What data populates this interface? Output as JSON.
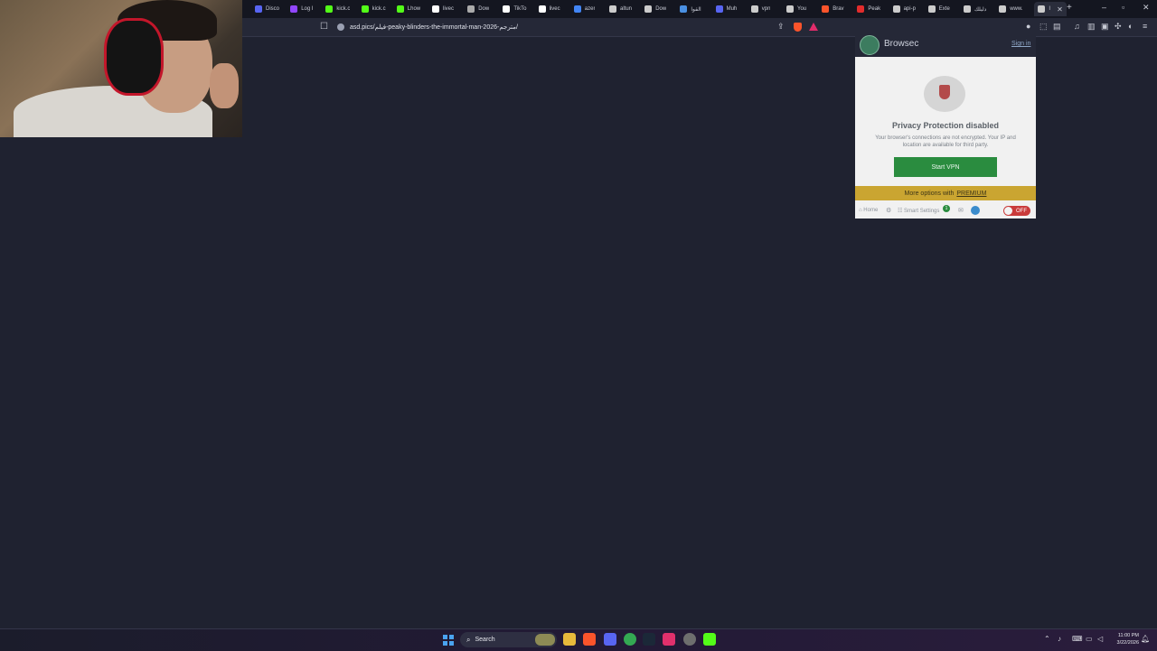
{
  "browser": {
    "tabs": [
      {
        "label": "Disco",
        "color": "#5865f2"
      },
      {
        "label": "Log I",
        "color": "#9146ff"
      },
      {
        "label": "kick.c",
        "color": "#53fc18"
      },
      {
        "label": "kick.c",
        "color": "#53fc18"
      },
      {
        "label": "Lhow",
        "color": "#53fc18"
      },
      {
        "label": "livec",
        "color": "#ffffff"
      },
      {
        "label": "Dow",
        "color": "#aaaaaa"
      },
      {
        "label": "TikTo",
        "color": "#ffffff"
      },
      {
        "label": "livec",
        "color": "#ffffff"
      },
      {
        "label": "azer",
        "color": "#4285f4"
      },
      {
        "label": "altun",
        "color": "#cccccc"
      },
      {
        "label": "Dow",
        "color": "#cccccc"
      },
      {
        "label": "القوا",
        "color": "#4a90e2"
      },
      {
        "label": "Muh",
        "color": "#5865f2"
      },
      {
        "label": "vpn",
        "color": "#cccccc"
      },
      {
        "label": "You",
        "color": "#cccccc"
      },
      {
        "label": "Brav",
        "color": "#fb542b"
      },
      {
        "label": "Peak",
        "color": "#e22c2c"
      },
      {
        "label": "api-p",
        "color": "#cccccc"
      },
      {
        "label": "Exte",
        "color": "#cccccc"
      },
      {
        "label": "دليلك",
        "color": "#cccccc"
      },
      {
        "label": "www.",
        "color": "#cccccc"
      },
      {
        "label": "I",
        "color": "#cccccc",
        "active": true
      }
    ],
    "new_tab": "+",
    "window_controls": {
      "minimize": "–",
      "maximize": "▫",
      "close": "✕"
    },
    "url": "asd.pics/فيلم-peaky-blinders-the-immortal-man-2026-مترجم/"
  },
  "browsec": {
    "title": "Browsec",
    "sign_in": "Sign in",
    "status": "Privacy Protection disabled",
    "description": "Your browser's connections are not encrypted. Your IP and location are available for third party.",
    "start_button": "Start VPN",
    "more_options": "More options with",
    "premium": "PREMIUM",
    "footer": {
      "home": "Home",
      "smart_settings": "Smart Settings",
      "badge": "1",
      "toggle": "OFF"
    }
  },
  "taskbar": {
    "search_placeholder": "Search",
    "time": "11:00 PM",
    "date": "3/22/2026"
  }
}
